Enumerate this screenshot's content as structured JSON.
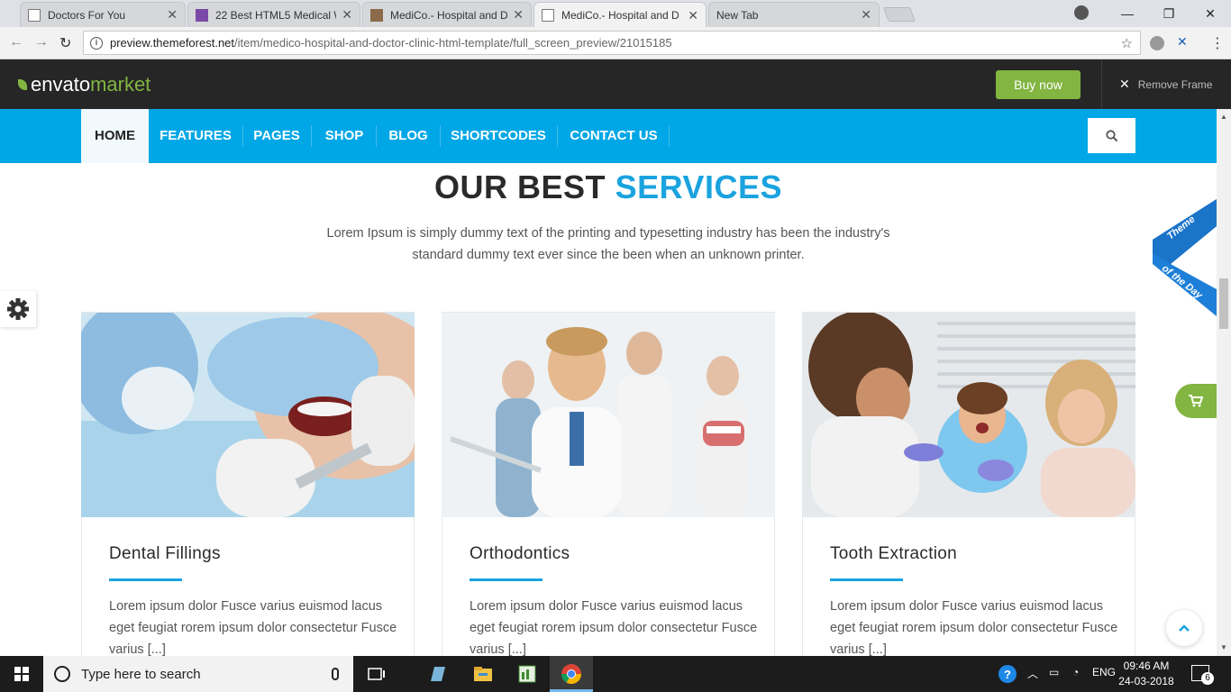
{
  "browser": {
    "tabs": [
      {
        "title": "Doctors For You",
        "favicon": "page-icon"
      },
      {
        "title": "22 Best HTML5 Medical W",
        "favicon": "colorlib-icon"
      },
      {
        "title": "MediCo.- Hospital and D",
        "favicon": "image-icon"
      },
      {
        "title": "MediCo.- Hospital and D",
        "favicon": "page-icon",
        "active": true
      },
      {
        "title": "New Tab",
        "favicon": "none"
      }
    ],
    "url_host": "preview.themeforest.net",
    "url_path": "/item/medico-hospital-and-doctor-clinic-html-template/full_screen_preview/21015185"
  },
  "envato": {
    "logo_word1": "envato",
    "logo_word2": "market",
    "buy_now": "Buy now",
    "remove_frame": "Remove Frame",
    "accent_color": "#82b541"
  },
  "site": {
    "nav": [
      "HOME",
      "FEATURES",
      "PAGES",
      "SHOP",
      "BLOG",
      "SHORTCODES",
      "CONTACT US"
    ],
    "nav_color": "#00a7e6",
    "section_title_part1": "OUR BEST",
    "section_title_part2": "SERVICES",
    "section_subtitle": "Lorem Ipsum is simply dummy text of the printing and typesetting industry has been the industry's standard dummy text ever since the been when an unknown printer.",
    "ribbon_line1": "Theme",
    "ribbon_line2": "of the Day",
    "services": [
      {
        "title": "Dental Fillings",
        "text": "Lorem ipsum dolor Fusce varius euismod lacus eget feugiat rorem ipsum dolor consectetur Fusce varius [...]"
      },
      {
        "title": "Orthodontics",
        "text": "Lorem ipsum dolor Fusce varius euismod lacus eget feugiat rorem ipsum dolor consectetur Fusce varius [...]"
      },
      {
        "title": "Tooth Extraction",
        "text": "Lorem ipsum dolor Fusce varius euismod lacus eget feugiat rorem ipsum dolor consectetur Fusce varius [...]"
      }
    ]
  },
  "taskbar": {
    "search_placeholder": "Type here to search",
    "language": "ENG",
    "time": "09:46 AM",
    "date": "24-03-2018",
    "notification_count": "6"
  }
}
